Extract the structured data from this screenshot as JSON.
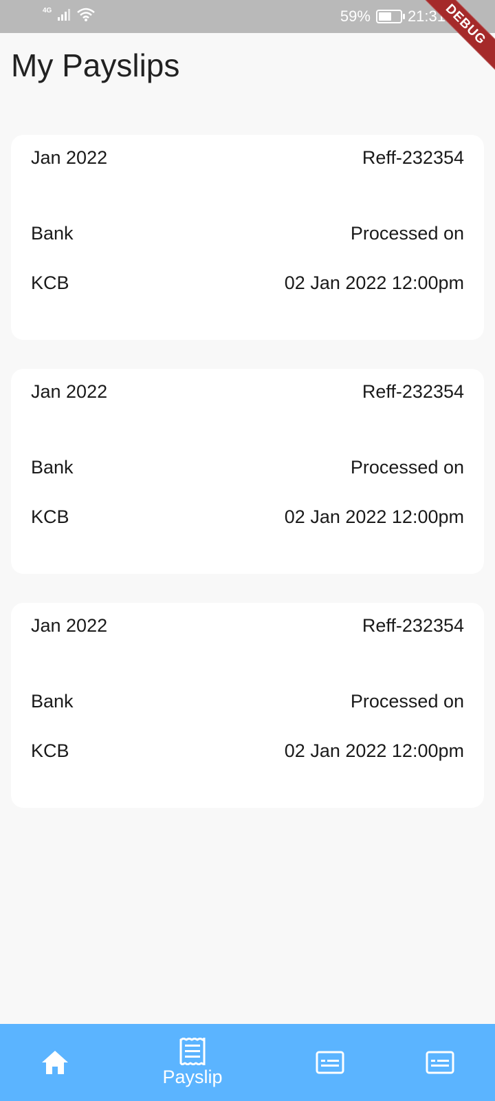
{
  "status_bar": {
    "network": "4G",
    "battery_percent": "59%",
    "battery_level": 0.59,
    "time": "21:31"
  },
  "debug_banner": "DEBUG",
  "page_title": "My Payslips",
  "payslips": [
    {
      "period": "Jan 2022",
      "reference": "Reff-232354",
      "bank_label": "Bank",
      "processed_label": "Processed on",
      "bank": "KCB",
      "processed_on": "02 Jan 2022 12:00pm"
    },
    {
      "period": "Jan 2022",
      "reference": "Reff-232354",
      "bank_label": "Bank",
      "processed_label": "Processed on",
      "bank": "KCB",
      "processed_on": "02 Jan 2022 12:00pm"
    },
    {
      "period": "Jan 2022",
      "reference": "Reff-232354",
      "bank_label": "Bank",
      "processed_label": "Processed on",
      "bank": "KCB",
      "processed_on": "02 Jan 2022 12:00pm"
    }
  ],
  "bottom_nav": {
    "background": "#5bb4ff",
    "items": [
      {
        "icon": "home-icon",
        "label": ""
      },
      {
        "icon": "receipt-icon",
        "label": "Payslip"
      },
      {
        "icon": "card-icon",
        "label": ""
      },
      {
        "icon": "card-icon",
        "label": ""
      }
    ]
  }
}
